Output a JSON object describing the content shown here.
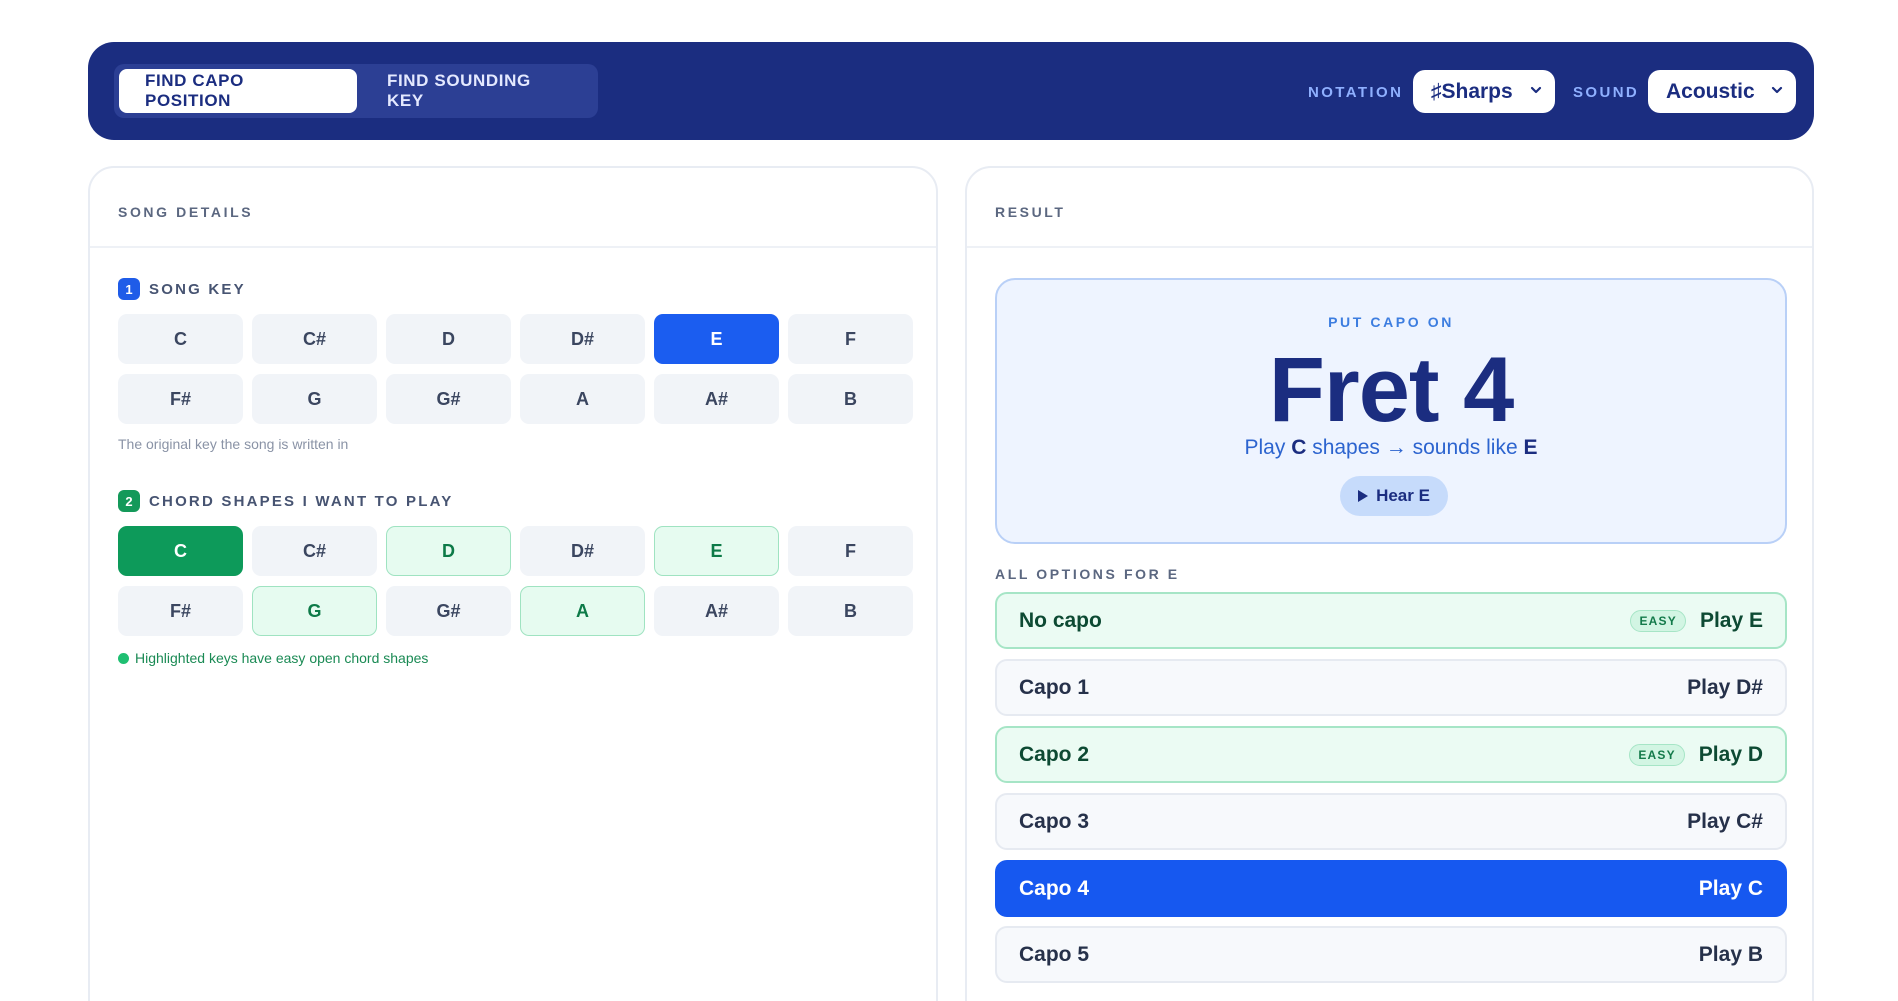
{
  "header": {
    "tabs": [
      {
        "label": "FIND CAPO POSITION",
        "active": true
      },
      {
        "label": "FIND SOUNDING KEY",
        "active": false
      }
    ],
    "notation": {
      "label": "NOTATION",
      "value": "♯Sharps"
    },
    "sound": {
      "label": "SOUND",
      "value": "Acoustic"
    }
  },
  "song_details": {
    "title": "SONG DETAILS",
    "song_key": {
      "number": "1",
      "label": "SONG KEY",
      "keys": [
        "C",
        "C#",
        "D",
        "D#",
        "E",
        "F",
        "F#",
        "G",
        "G#",
        "A",
        "A#",
        "B"
      ],
      "selected": "E",
      "hint": "The original key the song is written in"
    },
    "chord_shapes": {
      "number": "2",
      "label": "CHORD SHAPES I WANT TO PLAY",
      "keys": [
        "C",
        "C#",
        "D",
        "D#",
        "E",
        "F",
        "F#",
        "G",
        "G#",
        "A",
        "A#",
        "B"
      ],
      "selected": "C",
      "easy": [
        "D",
        "E",
        "G",
        "A"
      ],
      "hint": "Highlighted keys have easy open chord shapes"
    }
  },
  "result": {
    "title": "RESULT",
    "put_capo_label": "PUT CAPO ON",
    "fret_text": "Fret 4",
    "play_prefix": "Play",
    "play_shape": "C",
    "play_middle": "shapes → sounds like",
    "play_sounds": "E",
    "hear_button": "Hear E",
    "options_label": "ALL OPTIONS FOR E",
    "options": [
      {
        "name": "No capo",
        "play": "Play E",
        "easy": true,
        "active": false
      },
      {
        "name": "Capo 1",
        "play": "Play D#",
        "easy": false,
        "active": false
      },
      {
        "name": "Capo 2",
        "play": "Play D",
        "easy": true,
        "active": false
      },
      {
        "name": "Capo 3",
        "play": "Play C#",
        "easy": false,
        "active": false
      },
      {
        "name": "Capo 4",
        "play": "Play C",
        "easy": false,
        "active": true
      },
      {
        "name": "Capo 5",
        "play": "Play B",
        "easy": false,
        "active": false
      }
    ],
    "easy_badge": "EASY"
  },
  "colors": {
    "header_bg": "#1b2d80",
    "accent_blue": "#1b5df0",
    "accent_green": "#0d9a5a"
  }
}
